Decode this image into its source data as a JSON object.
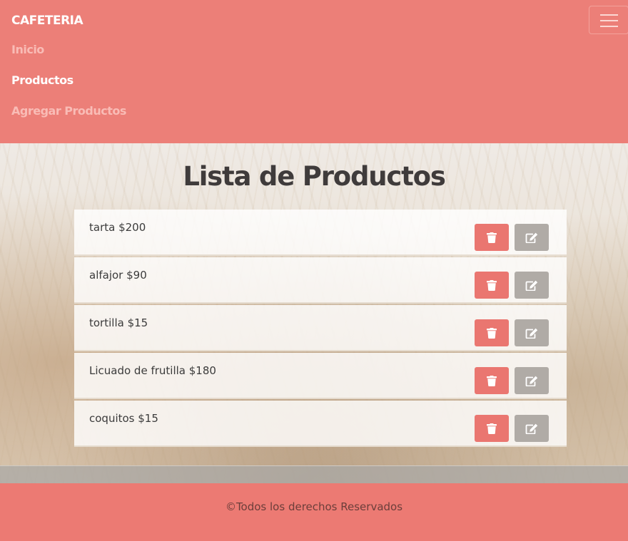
{
  "navbar": {
    "brand": "CAFETERIA",
    "links": [
      {
        "label": "Inicio",
        "state": "muted"
      },
      {
        "label": "Productos",
        "state": "active"
      },
      {
        "label": "Agregar Productos",
        "state": "muted"
      }
    ],
    "toggler_icon": "hamburger-icon"
  },
  "main": {
    "title": "Lista de Productos",
    "products": [
      {
        "text": "tarta $200"
      },
      {
        "text": "alfajor $90"
      },
      {
        "text": "tortilla $15"
      },
      {
        "text": "Licuado de frutilla $180"
      },
      {
        "text": "coquitos $15"
      }
    ],
    "delete_icon": "trash-icon",
    "edit_icon": "edit-icon"
  },
  "footer": {
    "text": "©Todos los derechos Reservados"
  },
  "colors": {
    "primary": "#ec7f78",
    "delete_button": "#ea7670",
    "edit_button": "#b0aba6"
  }
}
